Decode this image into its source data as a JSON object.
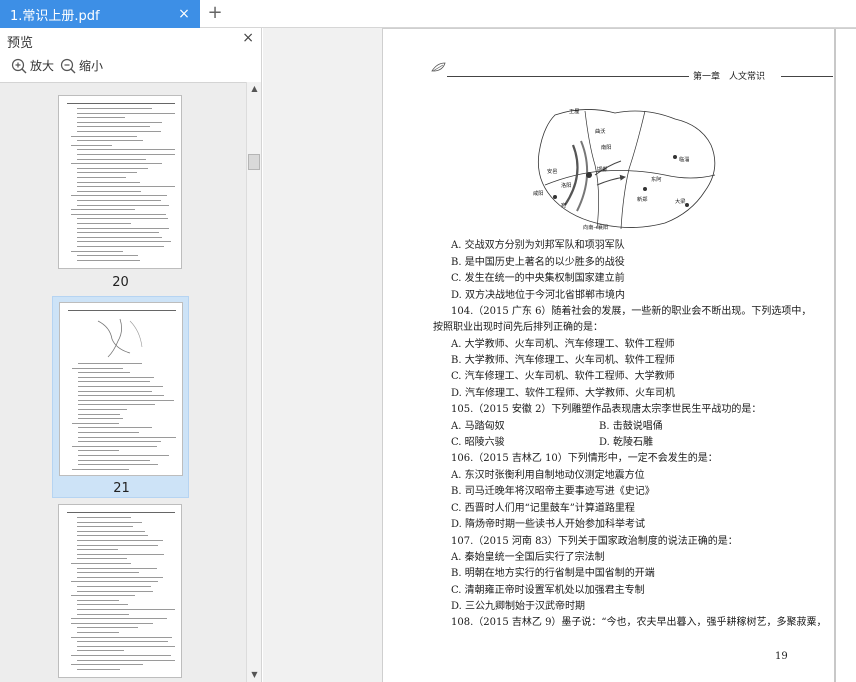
{
  "tab": {
    "title": "1.常识上册.pdf",
    "close_glyph": "×",
    "add_glyph": "+"
  },
  "preview": {
    "title": "预览",
    "close_glyph": "×",
    "zoom_in_label": "放大",
    "zoom_out_label": "缩小"
  },
  "thumbnails": [
    {
      "page_number": "20",
      "selected": false
    },
    {
      "page_number": "21",
      "selected": true
    },
    {
      "page_number": "",
      "selected": false
    }
  ],
  "scrollbar": {
    "up_glyph": "▲",
    "down_glyph": "▼"
  },
  "document": {
    "header": "第一章　人文常识",
    "map_labels": [
      "王屋",
      "曲沃",
      "南阳",
      "邯郸",
      "临淄",
      "咸阳",
      "洛阳",
      "宛",
      "东阿",
      "大梁",
      "新郑",
      "安邑",
      "向南→襄阳"
    ],
    "lines": [
      "A. 交战双方分别为刘邦军队和项羽军队",
      "B. 是中国历史上著名的以少胜多的战役",
      "C. 发生在统一的中央集权制国家建立前",
      "D. 双方决战地位于今河北省邯郸市境内",
      "104.（2015 广东 6）随着社会的发展，一些新的职业会不断出现。下列选项中，",
      "按照职业出现时间先后排列正确的是：",
      "A. 大学教师、火车司机、汽车修理工、软件工程师",
      "B. 大学教师、汽车修理工、火车司机、软件工程师",
      "C. 汽车修理工、火车司机、软件工程师、大学教师",
      "D. 汽车修理工、软件工程师、大学教师、火车司机",
      "105.（2015 安徽 2）下列雕塑作品表现唐太宗李世民生平战功的是：",
      "106.（2015 吉林乙 10）下列情形中，一定不会发生的是：",
      "A. 东汉时张衡利用自制地动仪测定地震方位",
      "B. 司马迁晚年将汉昭帝主要事迹写进《史记》",
      "C. 西晋时人们用“记里鼓车”计算道路里程",
      "D. 隋炀帝时期一些读书人开始参加科举考试",
      "107.（2015 河南 83）下列关于国家政治制度的说法正确的是：",
      "A. 秦始皇统一全国后实行了宗法制",
      "B. 明朝在地方实行的行省制是中国省制的开端",
      "C. 清朝雍正帝时设置军机处以加强君主专制",
      "D. 三公九卿制始于汉武帝时期",
      "108.（2015 吉林乙 9）墨子说：“今也，农夫早出暮入，强乎耕稼树艺，多聚菽粟，"
    ],
    "q105_options": {
      "a": "A. 马踏匈奴",
      "b": "B. 击鼓说唱俑",
      "c": "C. 昭陵六骏",
      "d": "D. 乾陵石雕"
    },
    "page_number": "19"
  }
}
